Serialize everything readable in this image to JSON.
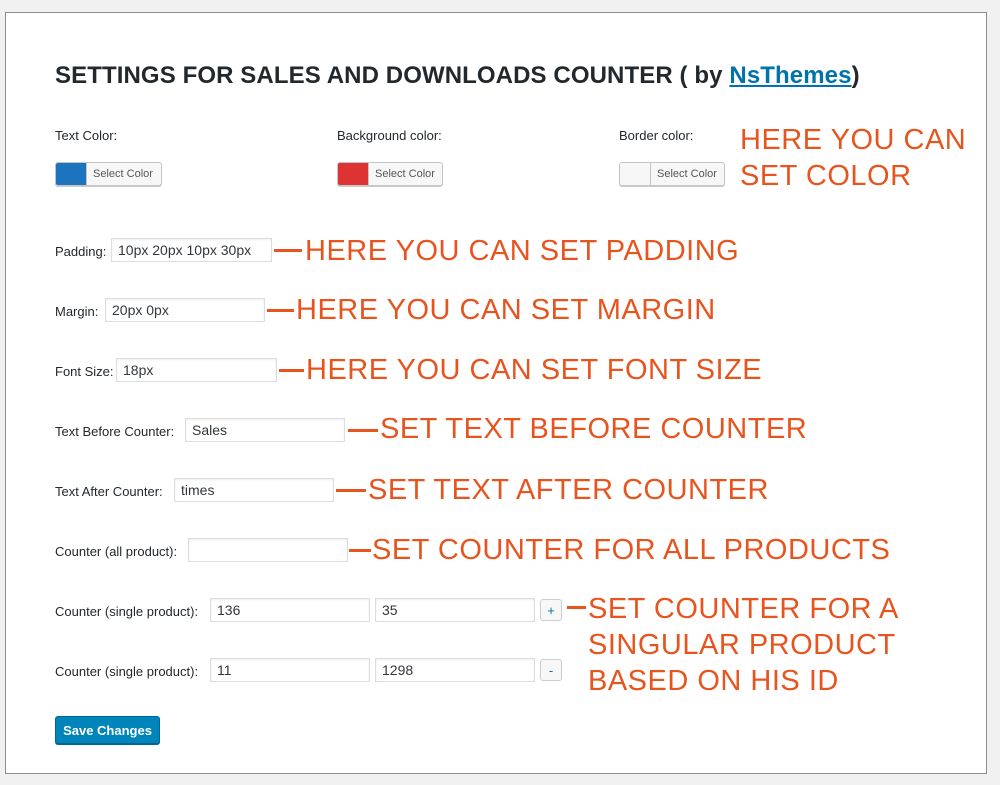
{
  "header": {
    "title_prefix": "SETTINGS FOR SALES AND DOWNLOADS COUNTER ( by ",
    "title_link": "NsThemes",
    "title_suffix": ")"
  },
  "colors": {
    "text_label": "Text Color:",
    "background_label": "Background color:",
    "border_label": "Border color:",
    "select_label": "Select Color",
    "text_swatch": "#1e73be",
    "background_swatch": "#dd3333",
    "border_swatch": "#f7f7f7"
  },
  "fields": {
    "padding_label": "Padding:",
    "padding_value": "10px 20px 10px 30px",
    "margin_label": "Margin:",
    "margin_value": "20px 0px",
    "font_size_label": "Font Size:",
    "font_size_value": "18px",
    "text_before_label": "Text Before Counter:",
    "text_before_value": "Sales",
    "text_after_label": "Text After Counter:",
    "text_after_value": "times",
    "counter_all_label": "Counter (all product):",
    "counter_all_value": ""
  },
  "single_counters": [
    {
      "label": "Counter (single product):",
      "id_value": "136",
      "count_value": "35",
      "button": "+"
    },
    {
      "label": "Counter (single product):",
      "id_value": "11",
      "count_value": "1298",
      "button": "-"
    }
  ],
  "save_label": "Save Changes",
  "annotations": {
    "color_line1": "HERE YOU CAN",
    "color_line2": "SET COLOR",
    "padding": "HERE YOU CAN SET PADDING",
    "margin": "HERE YOU CAN SET MARGIN",
    "font_size": "HERE YOU CAN SET FONT SIZE",
    "text_before": "SET TEXT BEFORE COUNTER",
    "text_after": "SET TEXT AFTER COUNTER",
    "counter_all": "SET COUNTER FOR ALL PRODUCTS",
    "single_line1": "SET COUNTER FOR A",
    "single_line2": "SINGULAR PRODUCT",
    "single_line3": "BASED ON HIS ID",
    "accent_color": "#e8541e"
  }
}
